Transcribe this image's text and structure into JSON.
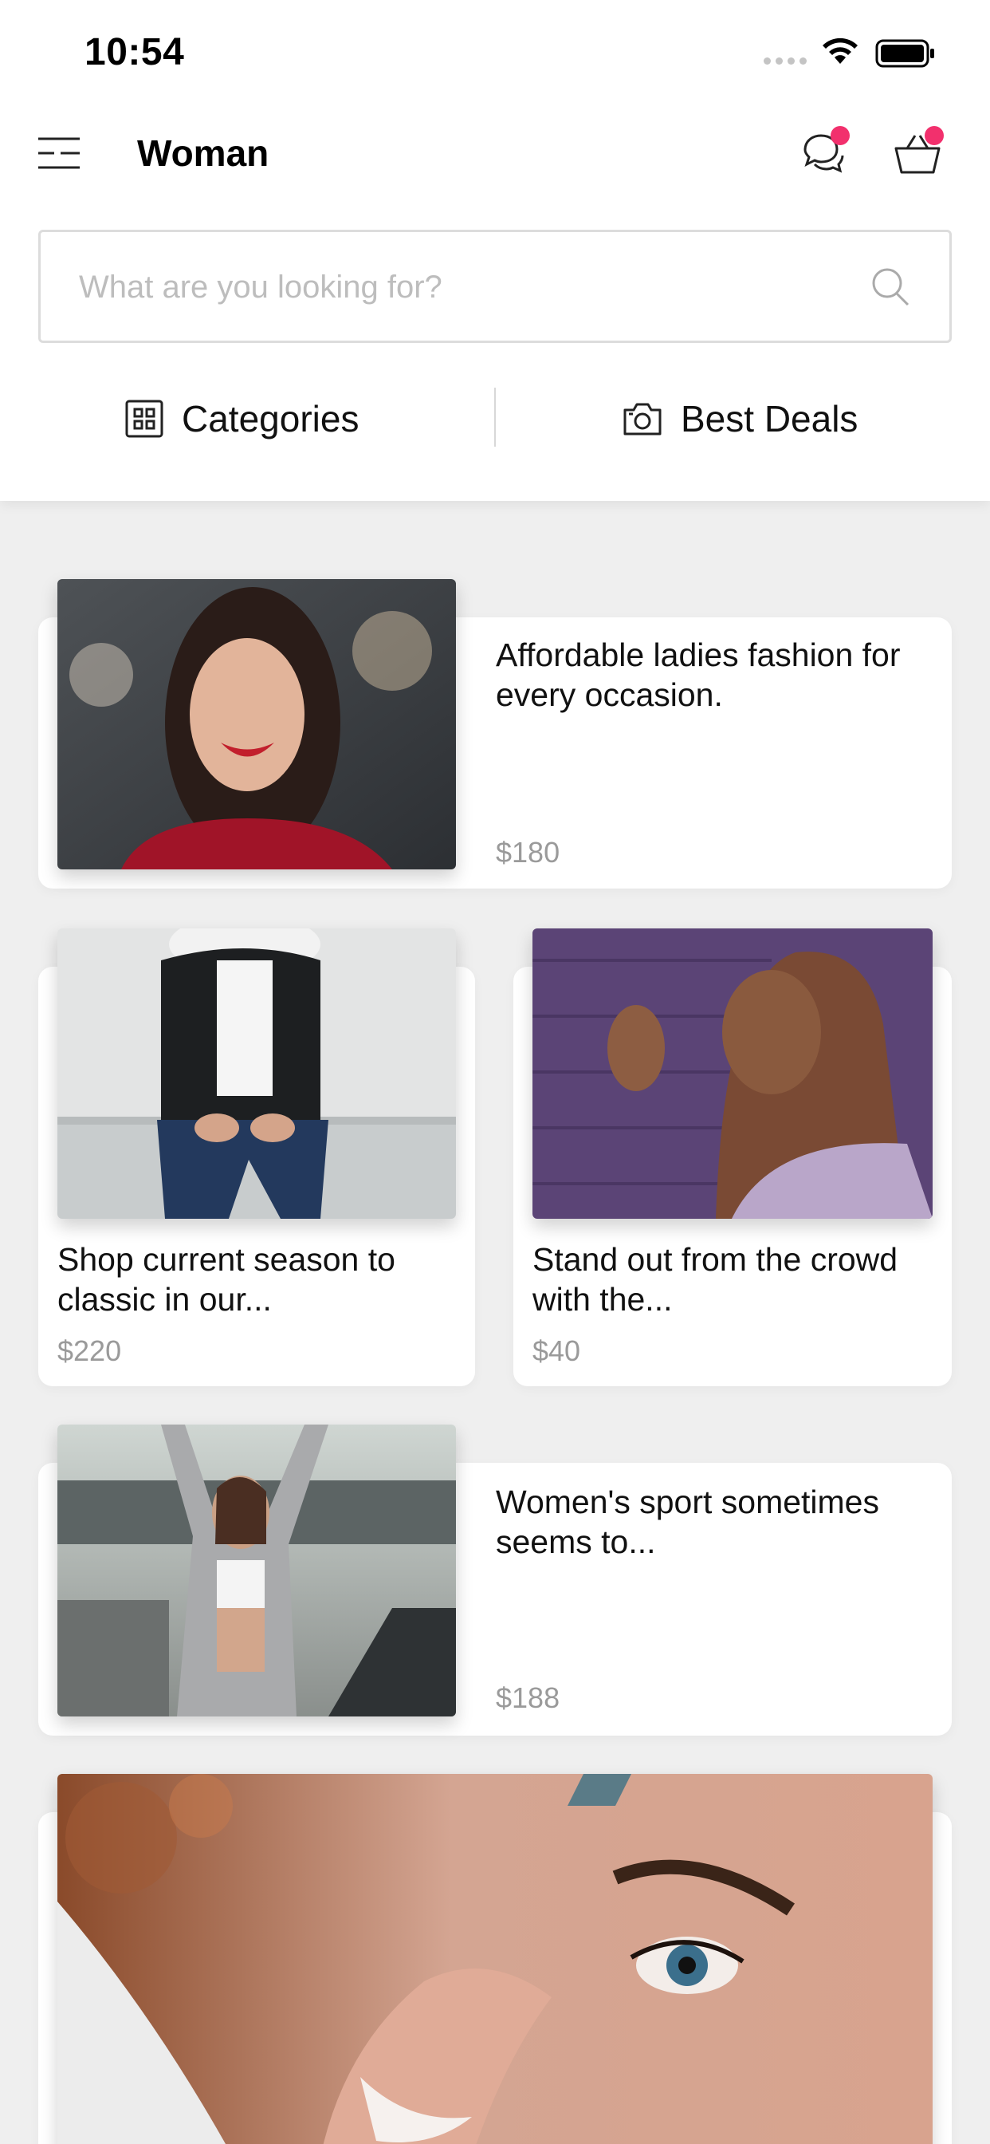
{
  "status_bar": {
    "time": "10:54"
  },
  "header": {
    "title": "Woman",
    "chat_badge": true,
    "cart_badge": true,
    "badge_color": "#f2306d"
  },
  "search": {
    "placeholder": "What are you looking for?",
    "value": ""
  },
  "tabs": [
    {
      "label": "Categories",
      "icon": "grid-icon"
    },
    {
      "label": "Best Deals",
      "icon": "camera-icon"
    }
  ],
  "products": [
    {
      "title": "Affordable ladies fashion for every occasion.",
      "price": "$180"
    },
    {
      "title": "Shop current season to classic in our...",
      "price": "$220"
    },
    {
      "title": "Stand out from the crowd with the...",
      "price": "$40"
    },
    {
      "title": "Women's sport sometimes seems to...",
      "price": "$188"
    }
  ],
  "colors": {
    "accent": "#f2306d",
    "background": "#efefef",
    "price": "#9a9a9a"
  }
}
